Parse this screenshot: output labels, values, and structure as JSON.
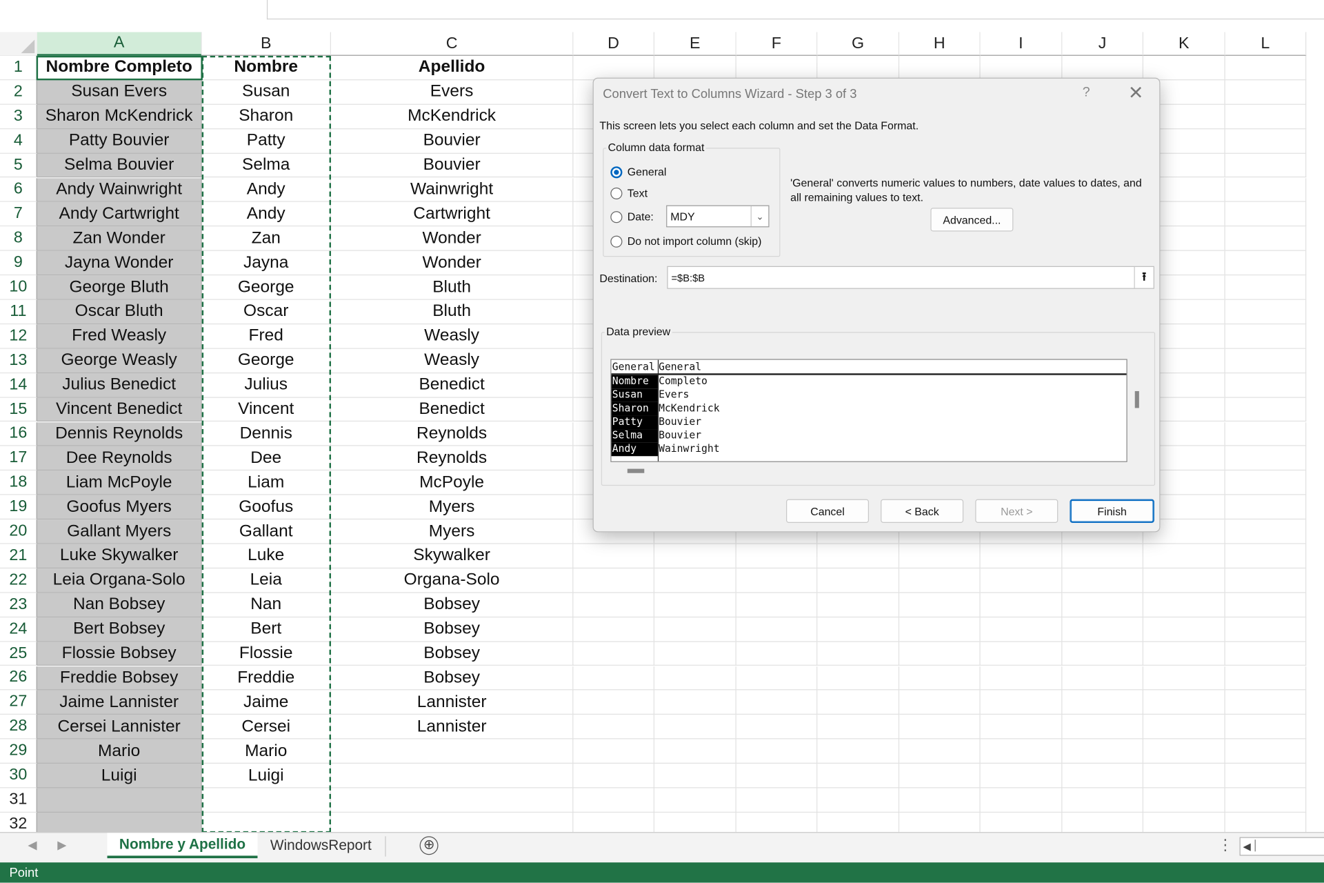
{
  "columns": [
    "A",
    "B",
    "C",
    "D",
    "E",
    "F",
    "G",
    "H",
    "I",
    "J",
    "K",
    "L"
  ],
  "rows": [
    [
      "Nombre Completo",
      "Nombre",
      "Apellido"
    ],
    [
      "Susan Evers",
      "Susan",
      "Evers"
    ],
    [
      "Sharon McKendrick",
      "Sharon",
      "McKendrick"
    ],
    [
      "Patty Bouvier",
      "Patty",
      "Bouvier"
    ],
    [
      "Selma Bouvier",
      "Selma",
      "Bouvier"
    ],
    [
      "Andy Wainwright",
      "Andy",
      "Wainwright"
    ],
    [
      "Andy Cartwright",
      "Andy",
      "Cartwright"
    ],
    [
      "Zan Wonder",
      "Zan",
      "Wonder"
    ],
    [
      "Jayna Wonder",
      "Jayna",
      "Wonder"
    ],
    [
      "George Bluth",
      "George",
      "Bluth"
    ],
    [
      "Oscar Bluth",
      "Oscar",
      "Bluth"
    ],
    [
      "Fred Weasly",
      "Fred",
      "Weasly"
    ],
    [
      "George Weasly",
      "George",
      "Weasly"
    ],
    [
      "Julius Benedict",
      "Julius",
      "Benedict"
    ],
    [
      "Vincent Benedict",
      "Vincent",
      "Benedict"
    ],
    [
      "Dennis Reynolds",
      "Dennis",
      "Reynolds"
    ],
    [
      "Dee Reynolds",
      "Dee",
      "Reynolds"
    ],
    [
      "Liam McPoyle",
      "Liam",
      "McPoyle"
    ],
    [
      "Goofus Myers",
      "Goofus",
      "Myers"
    ],
    [
      "Gallant Myers",
      "Gallant",
      "Myers"
    ],
    [
      "Luke Skywalker",
      "Luke",
      "Skywalker"
    ],
    [
      "Leia Organa-Solo",
      "Leia",
      "Organa-Solo"
    ],
    [
      "Nan Bobsey",
      "Nan",
      "Bobsey"
    ],
    [
      "Bert Bobsey",
      "Bert",
      "Bobsey"
    ],
    [
      "Flossie Bobsey",
      "Flossie",
      "Bobsey"
    ],
    [
      "Freddie Bobsey",
      "Freddie",
      "Bobsey"
    ],
    [
      "Jaime Lannister",
      "Jaime",
      "Lannister"
    ],
    [
      "Cersei Lannister",
      "Cersei",
      "Lannister"
    ],
    [
      "Mario",
      "Mario",
      ""
    ],
    [
      "Luigi",
      "Luigi",
      ""
    ],
    [
      "",
      "",
      ""
    ],
    [
      "",
      "",
      ""
    ]
  ],
  "sheet_tabs": {
    "active": "Nombre y Apellido",
    "other": "WindowsReport",
    "add_icon": "⊕",
    "prev_icon": "◀",
    "next_icon": "▶",
    "more_icon": "⋮"
  },
  "status": {
    "mode": "Point"
  },
  "dialog": {
    "title": "Convert Text to Columns Wizard - Step 3 of 3",
    "help": "?",
    "close": "✕",
    "description": "This screen lets you select each column and set the Data Format.",
    "format_group": "Column data format",
    "options": {
      "general": "General",
      "text": "Text",
      "date": "Date:",
      "skip": "Do not import column (skip)"
    },
    "selected_option": "general",
    "date_value": "MDY",
    "note": "'General' converts numeric values to numbers, date values to dates, and all remaining values to text.",
    "advanced": "Advanced...",
    "destination_label": "Destination:",
    "destination_value": "=$B:$B",
    "preview_label": "Data preview",
    "preview_headers": [
      "General",
      "General"
    ],
    "preview_rows": [
      [
        "Nombre",
        "Completo"
      ],
      [
        "Susan",
        "Evers"
      ],
      [
        "Sharon",
        "McKendrick"
      ],
      [
        "Patty",
        "Bouvier"
      ],
      [
        "Selma",
        "Bouvier"
      ],
      [
        "Andy",
        "Wainwright"
      ]
    ],
    "buttons": {
      "cancel": "Cancel",
      "back": "< Back",
      "next": "Next >",
      "finish": "Finish"
    }
  },
  "colors": {
    "accent": "#217346",
    "selection_fill": "#c9c9c9",
    "focus_blue": "#0067c0"
  }
}
